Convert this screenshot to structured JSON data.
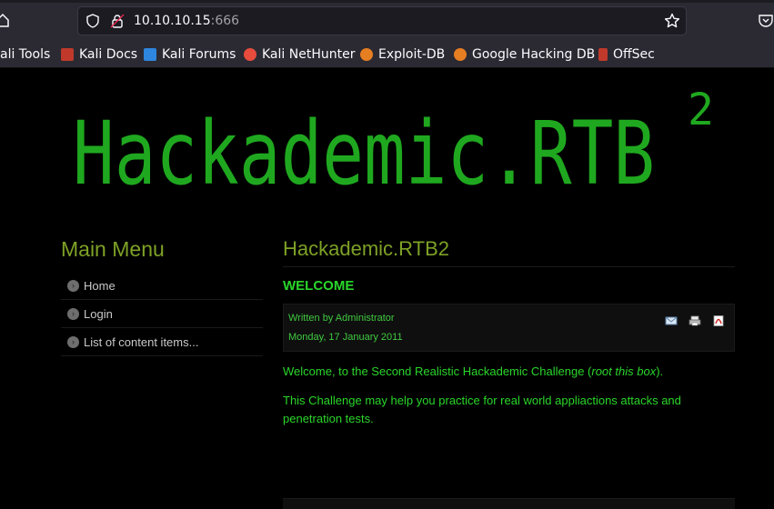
{
  "browser": {
    "url_host": "10.10.10.15",
    "url_port": ":666",
    "bookmarks": [
      {
        "label": "ali Tools",
        "icon": "kali-icon",
        "color": "#3a6ea5"
      },
      {
        "label": "Kali Docs",
        "icon": "kali-docs-icon",
        "color": "#c0392b"
      },
      {
        "label": "Kali Forums",
        "icon": "kali-forums-icon",
        "color": "#2e86de"
      },
      {
        "label": "Kali NetHunter",
        "icon": "nethunter-icon",
        "color": "#e74c3c"
      },
      {
        "label": "Exploit-DB",
        "icon": "exploit-db-icon",
        "color": "#e67e22"
      },
      {
        "label": "Google Hacking DB",
        "icon": "ghdb-icon",
        "color": "#e67e22"
      },
      {
        "label": "OffSec",
        "icon": "offsec-icon",
        "color": "#c0392b"
      }
    ]
  },
  "banner": {
    "title": "Hackademic.RTB",
    "superscript": "2",
    "color": "#1fa81f"
  },
  "sidebar": {
    "title": "Main Menu",
    "items": [
      {
        "label": "Home"
      },
      {
        "label": "Login"
      },
      {
        "label": "List of content items..."
      }
    ]
  },
  "article": {
    "title": "Hackademic.RTB2",
    "heading": "WELCOME",
    "author": "Written by Administrator",
    "date": "Monday, 17 January 2011",
    "tools": [
      "email-icon",
      "print-icon",
      "pdf-icon"
    ],
    "para1_prefix": "Welcome, to the Second Realistic Hackademic Challenge (",
    "para1_italic": "root this box",
    "para1_suffix": ").",
    "para2": "This Challenge may help you practice for real world appliactions attacks and penetration tests."
  },
  "colors": {
    "heading": "#7ea126",
    "text": "#2ad62a",
    "background": "#000000"
  }
}
